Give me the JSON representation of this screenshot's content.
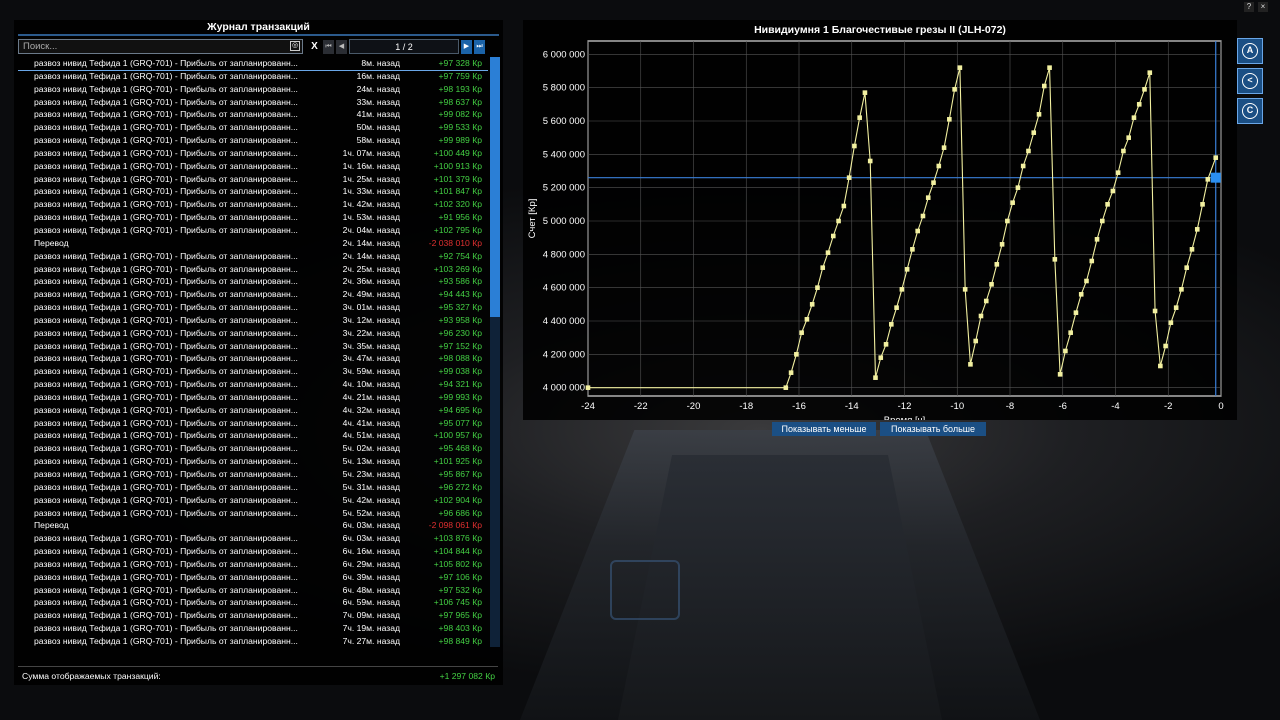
{
  "journal": {
    "title": "Журнал транзакций",
    "search_placeholder": "Поиск...",
    "clear_label": "X",
    "first_label": "⏮",
    "prev_label": "◀",
    "page": "1 / 2",
    "next_label": "▶",
    "last_label": "⏭",
    "rows": [
      {
        "d": "развоз нивид Тефида 1 (GRQ-701) - Прибыль от запланированн...",
        "t": "8м. назад",
        "a": "+97 328 Кр",
        "neg": false
      },
      {
        "d": "развоз нивид Тефида 1 (GRQ-701) - Прибыль от запланированн...",
        "t": "16м. назад",
        "a": "+97 759 Кр",
        "neg": false
      },
      {
        "d": "развоз нивид Тефида 1 (GRQ-701) - Прибыль от запланированн...",
        "t": "24м. назад",
        "a": "+98 193 Кр",
        "neg": false
      },
      {
        "d": "развоз нивид Тефида 1 (GRQ-701) - Прибыль от запланированн...",
        "t": "33м. назад",
        "a": "+98 637 Кр",
        "neg": false
      },
      {
        "d": "развоз нивид Тефида 1 (GRQ-701) - Прибыль от запланированн...",
        "t": "41м. назад",
        "a": "+99 082 Кр",
        "neg": false
      },
      {
        "d": "развоз нивид Тефида 1 (GRQ-701) - Прибыль от запланированн...",
        "t": "50м. назад",
        "a": "+99 533 Кр",
        "neg": false
      },
      {
        "d": "развоз нивид Тефида 1 (GRQ-701) - Прибыль от запланированн...",
        "t": "58м. назад",
        "a": "+99 989 Кр",
        "neg": false
      },
      {
        "d": "развоз нивид Тефида 1 (GRQ-701) - Прибыль от запланированн...",
        "t": "1ч. 07м. назад",
        "a": "+100 449 Кр",
        "neg": false
      },
      {
        "d": "развоз нивид Тефида 1 (GRQ-701) - Прибыль от запланированн...",
        "t": "1ч. 16м. назад",
        "a": "+100 913 Кр",
        "neg": false
      },
      {
        "d": "развоз нивид Тефида 1 (GRQ-701) - Прибыль от запланированн...",
        "t": "1ч. 25м. назад",
        "a": "+101 379 Кр",
        "neg": false
      },
      {
        "d": "развоз нивид Тефида 1 (GRQ-701) - Прибыль от запланированн...",
        "t": "1ч. 33м. назад",
        "a": "+101 847 Кр",
        "neg": false
      },
      {
        "d": "развоз нивид Тефида 1 (GRQ-701) - Прибыль от запланированн...",
        "t": "1ч. 42м. назад",
        "a": "+102 320 Кр",
        "neg": false
      },
      {
        "d": "развоз нивид Тефида 1 (GRQ-701) - Прибыль от запланированн...",
        "t": "1ч. 53м. назад",
        "a": "+91 956 Кр",
        "neg": false
      },
      {
        "d": "развоз нивид Тефида 1 (GRQ-701) - Прибыль от запланированн...",
        "t": "2ч. 04м. назад",
        "a": "+102 795 Кр",
        "neg": false
      },
      {
        "d": "Перевод",
        "t": "2ч. 14м. назад",
        "a": "-2 038 010 Кр",
        "neg": true
      },
      {
        "d": "развоз нивид Тефида 1 (GRQ-701) - Прибыль от запланированн...",
        "t": "2ч. 14м. назад",
        "a": "+92 754 Кр",
        "neg": false
      },
      {
        "d": "развоз нивид Тефида 1 (GRQ-701) - Прибыль от запланированн...",
        "t": "2ч. 25м. назад",
        "a": "+103 269 Кр",
        "neg": false
      },
      {
        "d": "развоз нивид Тефида 1 (GRQ-701) - Прибыль от запланированн...",
        "t": "2ч. 36м. назад",
        "a": "+93 586 Кр",
        "neg": false
      },
      {
        "d": "развоз нивид Тефида 1 (GRQ-701) - Прибыль от запланированн...",
        "t": "2ч. 49м. назад",
        "a": "+94 443 Кр",
        "neg": false
      },
      {
        "d": "развоз нивид Тефида 1 (GRQ-701) - Прибыль от запланированн...",
        "t": "3ч. 01м. назад",
        "a": "+95 327 Кр",
        "neg": false
      },
      {
        "d": "развоз нивид Тефида 1 (GRQ-701) - Прибыль от запланированн...",
        "t": "3ч. 12м. назад",
        "a": "+93 958 Кр",
        "neg": false
      },
      {
        "d": "развоз нивид Тефида 1 (GRQ-701) - Прибыль от запланированн...",
        "t": "3ч. 22м. назад",
        "a": "+96 230 Кр",
        "neg": false
      },
      {
        "d": "развоз нивид Тефида 1 (GRQ-701) - Прибыль от запланированн...",
        "t": "3ч. 35м. назад",
        "a": "+97 152 Кр",
        "neg": false
      },
      {
        "d": "развоз нивид Тефида 1 (GRQ-701) - Прибыль от запланированн...",
        "t": "3ч. 47м. назад",
        "a": "+98 088 Кр",
        "neg": false
      },
      {
        "d": "развоз нивид Тефида 1 (GRQ-701) - Прибыль от запланированн...",
        "t": "3ч. 59м. назад",
        "a": "+99 038 Кр",
        "neg": false
      },
      {
        "d": "развоз нивид Тефида 1 (GRQ-701) - Прибыль от запланированн...",
        "t": "4ч. 10м. назад",
        "a": "+94 321 Кр",
        "neg": false
      },
      {
        "d": "развоз нивид Тефида 1 (GRQ-701) - Прибыль от запланированн...",
        "t": "4ч. 21м. назад",
        "a": "+99 993 Кр",
        "neg": false
      },
      {
        "d": "развоз нивид Тефида 1 (GRQ-701) - Прибыль от запланированн...",
        "t": "4ч. 32м. назад",
        "a": "+94 695 Кр",
        "neg": false
      },
      {
        "d": "развоз нивид Тефида 1 (GRQ-701) - Прибыль от запланированн...",
        "t": "4ч. 41м. назад",
        "a": "+95 077 Кр",
        "neg": false
      },
      {
        "d": "развоз нивид Тефида 1 (GRQ-701) - Прибыль от запланированн...",
        "t": "4ч. 51м. назад",
        "a": "+100 957 Кр",
        "neg": false
      },
      {
        "d": "развоз нивид Тефида 1 (GRQ-701) - Прибыль от запланированн...",
        "t": "5ч. 02м. назад",
        "a": "+95 468 Кр",
        "neg": false
      },
      {
        "d": "развоз нивид Тефида 1 (GRQ-701) - Прибыль от запланированн...",
        "t": "5ч. 13м. назад",
        "a": "+101 925 Кр",
        "neg": false
      },
      {
        "d": "развоз нивид Тефида 1 (GRQ-701) - Прибыль от запланированн...",
        "t": "5ч. 23м. назад",
        "a": "+95 867 Кр",
        "neg": false
      },
      {
        "d": "развоз нивид Тефида 1 (GRQ-701) - Прибыль от запланированн...",
        "t": "5ч. 31м. назад",
        "a": "+96 272 Кр",
        "neg": false
      },
      {
        "d": "развоз нивид Тефида 1 (GRQ-701) - Прибыль от запланированн...",
        "t": "5ч. 42м. назад",
        "a": "+102 904 Кр",
        "neg": false
      },
      {
        "d": "развоз нивид Тефида 1 (GRQ-701) - Прибыль от запланированн...",
        "t": "5ч. 52м. назад",
        "a": "+96 686 Кр",
        "neg": false
      },
      {
        "d": "Перевод",
        "t": "6ч. 03м. назад",
        "a": "-2 098 061 Кр",
        "neg": true
      },
      {
        "d": "развоз нивид Тефида 1 (GRQ-701) - Прибыль от запланированн...",
        "t": "6ч. 03м. назад",
        "a": "+103 876 Кр",
        "neg": false
      },
      {
        "d": "развоз нивид Тефида 1 (GRQ-701) - Прибыль от запланированн...",
        "t": "6ч. 16м. назад",
        "a": "+104 844 Кр",
        "neg": false
      },
      {
        "d": "развоз нивид Тефида 1 (GRQ-701) - Прибыль от запланированн...",
        "t": "6ч. 29м. назад",
        "a": "+105 802 Кр",
        "neg": false
      },
      {
        "d": "развоз нивид Тефида 1 (GRQ-701) - Прибыль от запланированн...",
        "t": "6ч. 39м. назад",
        "a": "+97 106 Кр",
        "neg": false
      },
      {
        "d": "развоз нивид Тефида 1 (GRQ-701) - Прибыль от запланированн...",
        "t": "6ч. 48м. назад",
        "a": "+97 532 Кр",
        "neg": false
      },
      {
        "d": "развоз нивид Тефида 1 (GRQ-701) - Прибыль от запланированн...",
        "t": "6ч. 59м. назад",
        "a": "+106 745 Кр",
        "neg": false
      },
      {
        "d": "развоз нивид Тефида 1 (GRQ-701) - Прибыль от запланированн...",
        "t": "7ч. 09м. назад",
        "a": "+97 965 Кр",
        "neg": false
      },
      {
        "d": "развоз нивид Тефида 1 (GRQ-701) - Прибыль от запланированн...",
        "t": "7ч. 19м. назад",
        "a": "+98 403 Кр",
        "neg": false
      },
      {
        "d": "развоз нивид Тефида 1 (GRQ-701) - Прибыль от запланированн...",
        "t": "7ч. 27м. назад",
        "a": "+98 849 Кр",
        "neg": false
      }
    ],
    "sum_label": "Сумма отображаемых транзакций:",
    "sum_value": "+1 297 082 Кр"
  },
  "graph": {
    "title": "Нивидиумня 1 Благочестивые грезы II (JLH-072)",
    "show_less": "Показывать меньше",
    "show_more": "Показывать больше"
  },
  "side_buttons": [
    {
      "name": "autopilot-icon",
      "glyph": "A"
    },
    {
      "name": "share-icon",
      "glyph": "<"
    },
    {
      "name": "credits-icon",
      "glyph": "C"
    }
  ],
  "window_buttons": {
    "help": "?",
    "close": "×"
  },
  "colors": {
    "accent": "#1b63a8",
    "positive": "#44d044",
    "negative": "#e03030",
    "line": "#f2f0a0"
  },
  "chart_data": {
    "type": "line",
    "title": "Нивидиумня 1 Благочестивые грезы II (JLH-072)",
    "xlabel": "Время [ч]",
    "ylabel": "Счет [Кр]",
    "xlim": [
      -24,
      0
    ],
    "ylim": [
      3950000,
      6080000
    ],
    "x_ticks": [
      -24,
      -22,
      -20,
      -18,
      -16,
      -14,
      -12,
      -10,
      -8,
      -6,
      -4,
      -2,
      0
    ],
    "y_ticks": [
      4000000,
      4200000,
      4400000,
      4600000,
      4800000,
      5000000,
      5200000,
      5400000,
      5600000,
      5800000,
      6000000
    ],
    "y_tick_labels": [
      "4 000 000",
      "4 200 000",
      "4 400 000",
      "4 600 000",
      "4 800 000",
      "5 000 000",
      "5 200 000",
      "5 400 000",
      "5 600 000",
      "5 800 000",
      "6 000 000"
    ],
    "cursor": {
      "x": -0.2,
      "y": 5260000
    },
    "grid": true,
    "series": [
      {
        "points": [
          [
            -24,
            4000000
          ],
          [
            -16.5,
            4000000
          ],
          [
            -16.3,
            4090000
          ],
          [
            -16.1,
            4200000
          ],
          [
            -15.9,
            4330000
          ],
          [
            -15.7,
            4410000
          ],
          [
            -15.5,
            4500000
          ],
          [
            -15.3,
            4600000
          ],
          [
            -15.1,
            4720000
          ],
          [
            -14.9,
            4810000
          ],
          [
            -14.7,
            4910000
          ],
          [
            -14.5,
            5000000
          ],
          [
            -14.3,
            5090000
          ],
          [
            -14.1,
            5260000
          ],
          [
            -13.9,
            5450000
          ],
          [
            -13.7,
            5620000
          ],
          [
            -13.5,
            5770000
          ],
          [
            -13.3,
            5360000
          ],
          [
            -13.1,
            4060000
          ],
          [
            -12.9,
            4180000
          ],
          [
            -12.7,
            4260000
          ],
          [
            -12.5,
            4380000
          ],
          [
            -12.3,
            4480000
          ],
          [
            -12.1,
            4590000
          ],
          [
            -11.9,
            4710000
          ],
          [
            -11.7,
            4830000
          ],
          [
            -11.5,
            4940000
          ],
          [
            -11.3,
            5030000
          ],
          [
            -11.1,
            5140000
          ],
          [
            -10.9,
            5230000
          ],
          [
            -10.7,
            5330000
          ],
          [
            -10.5,
            5440000
          ],
          [
            -10.3,
            5610000
          ],
          [
            -10.1,
            5790000
          ],
          [
            -9.9,
            5920000
          ],
          [
            -9.7,
            4590000
          ],
          [
            -9.5,
            4140000
          ],
          [
            -9.3,
            4280000
          ],
          [
            -9.1,
            4430000
          ],
          [
            -8.9,
            4520000
          ],
          [
            -8.7,
            4620000
          ],
          [
            -8.5,
            4740000
          ],
          [
            -8.3,
            4860000
          ],
          [
            -8.1,
            5000000
          ],
          [
            -7.9,
            5110000
          ],
          [
            -7.7,
            5200000
          ],
          [
            -7.5,
            5330000
          ],
          [
            -7.3,
            5420000
          ],
          [
            -7.1,
            5530000
          ],
          [
            -6.9,
            5640000
          ],
          [
            -6.7,
            5810000
          ],
          [
            -6.5,
            5920000
          ],
          [
            -6.3,
            4770000
          ],
          [
            -6.1,
            4080000
          ],
          [
            -5.9,
            4220000
          ],
          [
            -5.7,
            4330000
          ],
          [
            -5.5,
            4450000
          ],
          [
            -5.3,
            4560000
          ],
          [
            -5.1,
            4640000
          ],
          [
            -4.9,
            4760000
          ],
          [
            -4.7,
            4890000
          ],
          [
            -4.5,
            5000000
          ],
          [
            -4.3,
            5100000
          ],
          [
            -4.1,
            5180000
          ],
          [
            -3.9,
            5290000
          ],
          [
            -3.7,
            5420000
          ],
          [
            -3.5,
            5500000
          ],
          [
            -3.3,
            5620000
          ],
          [
            -3.1,
            5700000
          ],
          [
            -2.9,
            5790000
          ],
          [
            -2.7,
            5890000
          ],
          [
            -2.5,
            4460000
          ],
          [
            -2.3,
            4130000
          ],
          [
            -2.1,
            4250000
          ],
          [
            -1.9,
            4390000
          ],
          [
            -1.7,
            4480000
          ],
          [
            -1.5,
            4590000
          ],
          [
            -1.3,
            4720000
          ],
          [
            -1.1,
            4830000
          ],
          [
            -0.9,
            4950000
          ],
          [
            -0.7,
            5100000
          ],
          [
            -0.5,
            5250000
          ],
          [
            -0.2,
            5380000
          ]
        ]
      }
    ]
  }
}
